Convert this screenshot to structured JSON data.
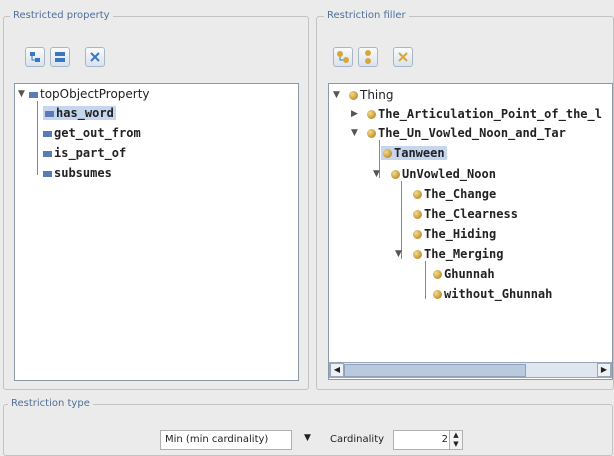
{
  "restricted_property": {
    "title": "Restricted property",
    "toolbar": [
      "add-subproperty-icon",
      "add-sibling-icon",
      "delete-icon"
    ],
    "root": "topObjectProperty",
    "items": [
      "has_word",
      "get_out_from",
      "is_part_of",
      "subsumes"
    ]
  },
  "restriction_filler": {
    "title": "Restriction filler",
    "toolbar": [
      "add-subclass-icon",
      "add-sibling-icon",
      "delete-icon"
    ],
    "root": "Thing",
    "level1": [
      "The_Articulation_Point_of_the_l",
      "The_Un_Vowled_Noon_and_Tar"
    ],
    "tanween": "Tanween",
    "unvowled": "UnVowled_Noon",
    "level3": [
      "The_Change",
      "The_Clearness",
      "The_Hiding",
      "The_Merging"
    ],
    "level4": [
      "Ghunnah",
      "without_Ghunnah"
    ]
  },
  "restriction_type": {
    "title": "Restriction type",
    "selected": "Min (min cardinality)",
    "cardinality_label": "Cardinality",
    "cardinality_value": "2"
  },
  "colors": {
    "selection": "#c5d6ee",
    "title": "#4f6f9a",
    "class_dot": "#d4a83a",
    "property_square": "#5b7bb7"
  }
}
